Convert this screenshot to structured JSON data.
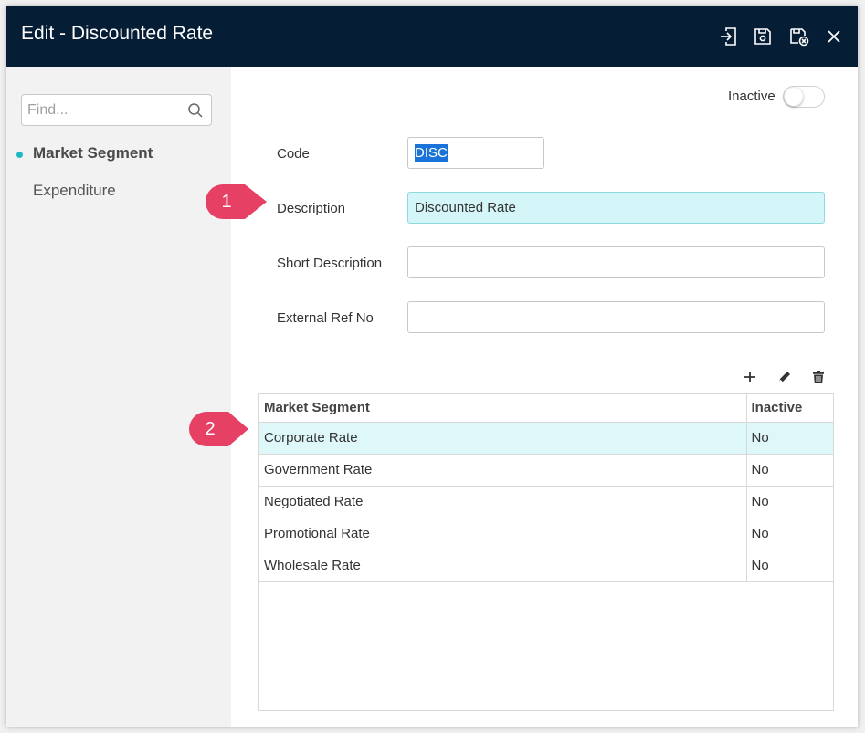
{
  "window": {
    "title": "Edit - Discounted Rate",
    "toolbar": {
      "icons": [
        "export-icon",
        "save-icon",
        "save-close-icon",
        "close-icon"
      ]
    }
  },
  "sidebar": {
    "search_placeholder": "Find...",
    "items": [
      {
        "label": "Market Segment",
        "active": true
      },
      {
        "label": "Expenditure",
        "active": false
      }
    ]
  },
  "form": {
    "inactive_label": "Inactive",
    "inactive_value": false,
    "code_label": "Code",
    "code_value": "DISC",
    "description_label": "Description",
    "description_value": "Discounted Rate",
    "short_description_label": "Short Description",
    "short_description_value": "",
    "external_ref_label": "External Ref No",
    "external_ref_value": ""
  },
  "grid": {
    "headers": [
      "Market Segment",
      "Inactive"
    ],
    "rows": [
      {
        "segment": "Corporate Rate",
        "inactive": "No"
      },
      {
        "segment": "Government Rate",
        "inactive": "No"
      },
      {
        "segment": "Negotiated Rate",
        "inactive": "No"
      },
      {
        "segment": "Promotional Rate",
        "inactive": "No"
      },
      {
        "segment": "Wholesale Rate",
        "inactive": "No"
      }
    ],
    "selected_row": 0
  },
  "callouts": [
    "1",
    "2"
  ],
  "colors": {
    "titlebar": "#061d36",
    "accent": "#1fb9c4",
    "focus_fill": "#d4f6f8",
    "selection": "#1a73d8",
    "callout": "#e64065"
  }
}
